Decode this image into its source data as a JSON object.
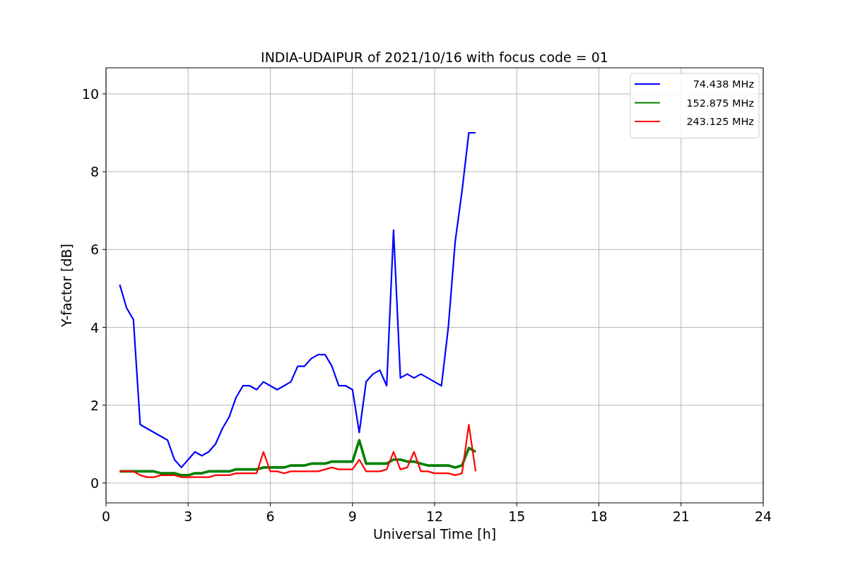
{
  "chart_data": {
    "type": "line",
    "title": "INDIA-UDAIPUR of 2021/10/16 with focus code = 01",
    "xlabel": "Universal Time [h]",
    "ylabel": "Y-factor [dB]",
    "x": [
      0.5,
      0.75,
      1.0,
      1.25,
      1.5,
      1.75,
      2.0,
      2.25,
      2.5,
      2.75,
      3.0,
      3.25,
      3.5,
      3.75,
      4.0,
      4.25,
      4.5,
      4.75,
      5.0,
      5.25,
      5.5,
      5.75,
      6.0,
      6.25,
      6.5,
      6.75,
      7.0,
      7.25,
      7.5,
      7.75,
      8.0,
      8.25,
      8.5,
      8.75,
      9.0,
      9.25,
      9.5,
      9.75,
      10.0,
      10.25,
      10.5,
      10.75,
      11.0,
      11.25,
      11.5,
      11.75,
      12.0,
      12.25,
      12.5,
      12.75,
      13.0,
      13.25,
      13.5
    ],
    "series": [
      {
        "name": "74.438 MHz",
        "color": "#0000ff",
        "values": [
          5.1,
          4.5,
          4.2,
          1.5,
          1.4,
          1.3,
          1.2,
          1.1,
          0.6,
          0.4,
          0.6,
          0.8,
          0.7,
          0.8,
          1.0,
          1.4,
          1.7,
          2.2,
          2.5,
          2.5,
          2.4,
          2.6,
          2.5,
          2.4,
          2.5,
          2.6,
          3.0,
          3.0,
          3.2,
          3.3,
          3.3,
          3.0,
          2.5,
          2.5,
          2.4,
          1.3,
          2.6,
          2.8,
          2.9,
          2.5,
          6.5,
          2.7,
          2.8,
          2.7,
          2.8,
          2.7,
          2.6,
          2.5,
          4.0,
          6.2,
          7.5,
          9.0,
          9.0
        ]
      },
      {
        "name": "152.875 MHz",
        "color": "#008000",
        "values": [
          0.3,
          0.3,
          0.3,
          0.3,
          0.3,
          0.3,
          0.25,
          0.25,
          0.25,
          0.2,
          0.2,
          0.25,
          0.25,
          0.3,
          0.3,
          0.3,
          0.3,
          0.35,
          0.35,
          0.35,
          0.35,
          0.4,
          0.4,
          0.4,
          0.4,
          0.45,
          0.45,
          0.45,
          0.5,
          0.5,
          0.5,
          0.55,
          0.55,
          0.55,
          0.55,
          1.1,
          0.5,
          0.5,
          0.5,
          0.5,
          0.6,
          0.6,
          0.55,
          0.55,
          0.5,
          0.45,
          0.45,
          0.45,
          0.45,
          0.4,
          0.45,
          0.9,
          0.8
        ]
      },
      {
        "name": "243.125 MHz",
        "color": "#ff0000",
        "values": [
          0.3,
          0.3,
          0.3,
          0.2,
          0.15,
          0.15,
          0.2,
          0.2,
          0.2,
          0.15,
          0.15,
          0.15,
          0.15,
          0.15,
          0.2,
          0.2,
          0.2,
          0.25,
          0.25,
          0.25,
          0.25,
          0.8,
          0.3,
          0.3,
          0.25,
          0.3,
          0.3,
          0.3,
          0.3,
          0.3,
          0.35,
          0.4,
          0.35,
          0.35,
          0.35,
          0.6,
          0.3,
          0.3,
          0.3,
          0.35,
          0.8,
          0.35,
          0.4,
          0.8,
          0.3,
          0.3,
          0.25,
          0.25,
          0.25,
          0.2,
          0.25,
          1.5,
          0.3
        ]
      }
    ],
    "xlim": [
      0,
      24
    ],
    "ylim": [
      -0.51,
      10.67
    ],
    "xticks": [
      0,
      3,
      6,
      9,
      12,
      15,
      18,
      21,
      24
    ],
    "yticks": [
      0,
      2,
      4,
      6,
      8,
      10
    ],
    "grid": true,
    "legend": true
  }
}
